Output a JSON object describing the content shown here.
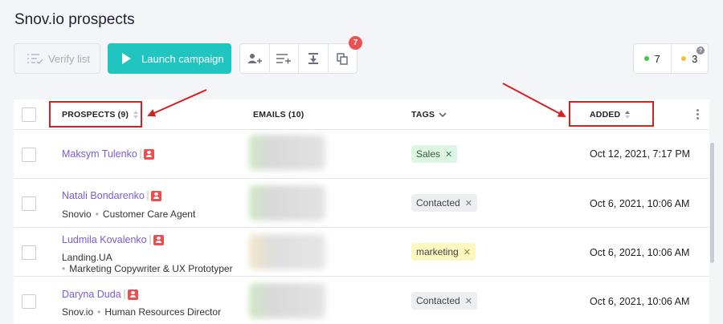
{
  "page": {
    "title": "Snov.io prospects"
  },
  "toolbar": {
    "verify_label": "Verify list",
    "launch_label": "Launch campaign",
    "icons": [
      "add-prospect-icon",
      "add-to-list-icon",
      "download-icon",
      "copy-icon"
    ],
    "badge_count": "7"
  },
  "counters": {
    "green": "7",
    "yellow": "3"
  },
  "table": {
    "headers": {
      "prospects": "PROSPECTS (9)",
      "emails": "EMAILS (10)",
      "tags": "TAGS",
      "added": "ADDED"
    },
    "rows": [
      {
        "name": "Maksym Tulenko",
        "company": "",
        "position": "",
        "tag": "Sales",
        "added": "Oct 12, 2021, 7:17 PM"
      },
      {
        "name": "Natali Bondarenko",
        "company": "Snovio",
        "position": "Customer Care Agent",
        "tag": "Contacted",
        "added": "Oct 6, 2021, 10:06 AM"
      },
      {
        "name": "Ludmila Kovalenko",
        "company": "Landing.UA",
        "position": "Marketing Copywriter & UX Prototyper",
        "tag": "marketing",
        "added": "Oct 6, 2021, 10:06 AM"
      },
      {
        "name": "Daryna Duda",
        "company": "Snov.io",
        "position": "Human Resources Director",
        "tag": "Contacted",
        "added": "Oct 6, 2021, 10:06 AM"
      }
    ]
  },
  "colors": {
    "accent": "#21c5c0",
    "link": "#7b5cd6",
    "highlight": "#d62020"
  }
}
